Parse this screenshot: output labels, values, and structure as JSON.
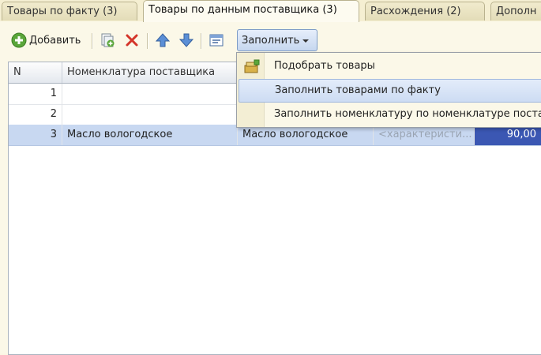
{
  "tabs": [
    {
      "label": "Товары по факту (3)"
    },
    {
      "label": "Товары по данным поставщика (3)"
    },
    {
      "label": "Расхождения (2)"
    },
    {
      "label": "Дополн"
    }
  ],
  "toolbar": {
    "add_label": "Добавить",
    "fill_label": "Заполнить"
  },
  "table": {
    "columns": [
      "N",
      "Номенклатура поставщика"
    ],
    "rows": [
      {
        "n": "1",
        "supplier_item": "",
        "item": "",
        "characteristic": "",
        "value": ""
      },
      {
        "n": "2",
        "supplier_item": "",
        "item": "",
        "characteristic": "",
        "value": ""
      },
      {
        "n": "3",
        "supplier_item": "Масло вологодское",
        "item": "Масло вологодское",
        "characteristic": "<характеристи...",
        "value": "90,00"
      }
    ]
  },
  "menu": {
    "items": [
      {
        "label": "Подобрать товары",
        "icon": "pick-goods-icon"
      },
      {
        "label": "Заполнить товарами по факту",
        "icon": ""
      },
      {
        "label": "Заполнить номенклатуру по номенклатуре поста",
        "icon": ""
      }
    ]
  }
}
